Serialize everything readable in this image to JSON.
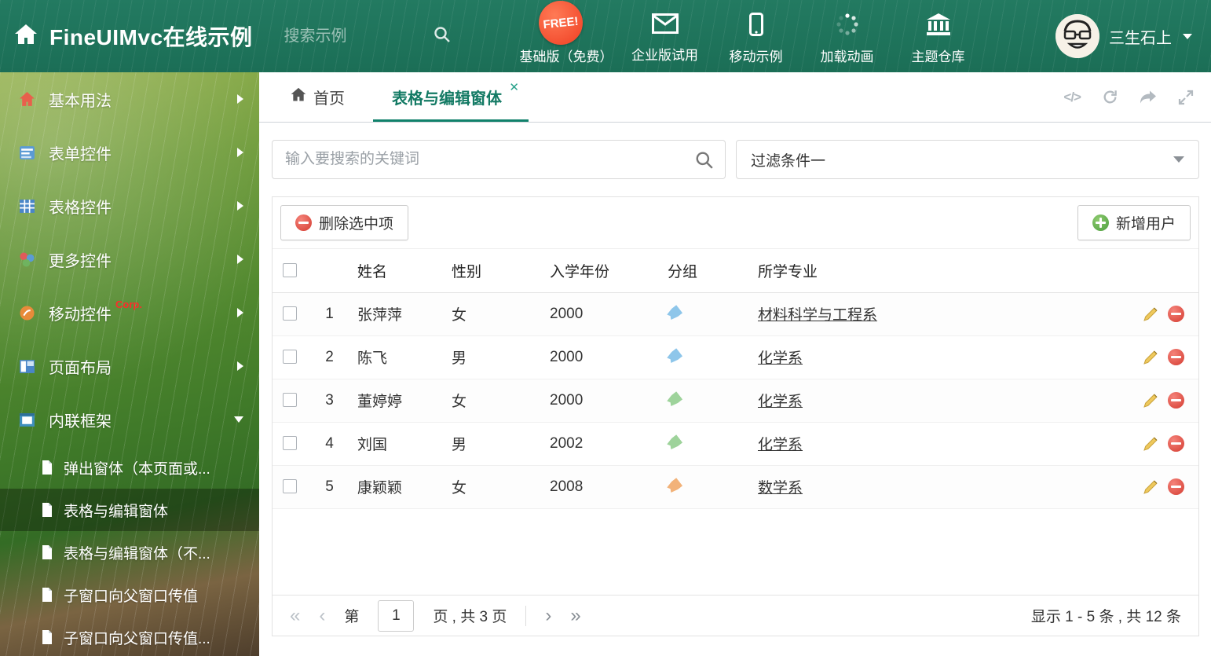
{
  "colors": {
    "header_green": "#1e7660",
    "accent_teal": "#10816b",
    "free_red": "#ef3f23"
  },
  "header": {
    "title": "FineUIMvc在线示例",
    "search_placeholder": "搜索示例",
    "free_badge": "FREE!",
    "nav": [
      {
        "label": "基础版（免费）"
      },
      {
        "label": "企业版试用"
      },
      {
        "label": "移动示例"
      },
      {
        "label": "加载动画"
      },
      {
        "label": "主题仓库"
      }
    ],
    "user": "三生石上"
  },
  "sidebar": {
    "items": [
      {
        "label": "基本用法"
      },
      {
        "label": "表单控件"
      },
      {
        "label": "表格控件"
      },
      {
        "label": "更多控件"
      },
      {
        "label": "移动控件",
        "badge": "Corp."
      },
      {
        "label": "页面布局"
      },
      {
        "label": "内联框架",
        "expanded": true
      }
    ],
    "subitems": [
      {
        "label": "弹出窗体（本页面或..."
      },
      {
        "label": "表格与编辑窗体",
        "active": true
      },
      {
        "label": "表格与编辑窗体（不..."
      },
      {
        "label": "子窗口向父窗口传值"
      },
      {
        "label": "子窗口向父窗口传值..."
      }
    ]
  },
  "tabs": [
    {
      "label": "首页"
    },
    {
      "label": "表格与编辑窗体",
      "active": true
    }
  ],
  "filters": {
    "search_placeholder": "输入要搜索的关键词",
    "filter_value": "过滤条件一"
  },
  "toolbar": {
    "delete_label": "删除选中项",
    "add_label": "新增用户"
  },
  "table": {
    "columns": [
      "姓名",
      "性别",
      "入学年份",
      "分组",
      "所学专业"
    ],
    "rows": [
      {
        "num": "1",
        "name": "张萍萍",
        "gender": "女",
        "year": "2000",
        "tag_color": "#8ec6ea",
        "major": "材料科学与工程系"
      },
      {
        "num": "2",
        "name": "陈飞",
        "gender": "男",
        "year": "2000",
        "tag_color": "#8ec6ea",
        "major": "化学系"
      },
      {
        "num": "3",
        "name": "董婷婷",
        "gender": "女",
        "year": "2000",
        "tag_color": "#9ed39b",
        "major": "化学系"
      },
      {
        "num": "4",
        "name": "刘国",
        "gender": "男",
        "year": "2002",
        "tag_color": "#9ed39b",
        "major": "化学系"
      },
      {
        "num": "5",
        "name": "康颖颖",
        "gender": "女",
        "year": "2008",
        "tag_color": "#f2b279",
        "major": "数学系"
      }
    ]
  },
  "pagination": {
    "page_label_prefix": "第",
    "current_page": "1",
    "page_label_suffix": "页 , 共 3 页",
    "summary": "显示 1 - 5 条 , 共 12 条"
  }
}
